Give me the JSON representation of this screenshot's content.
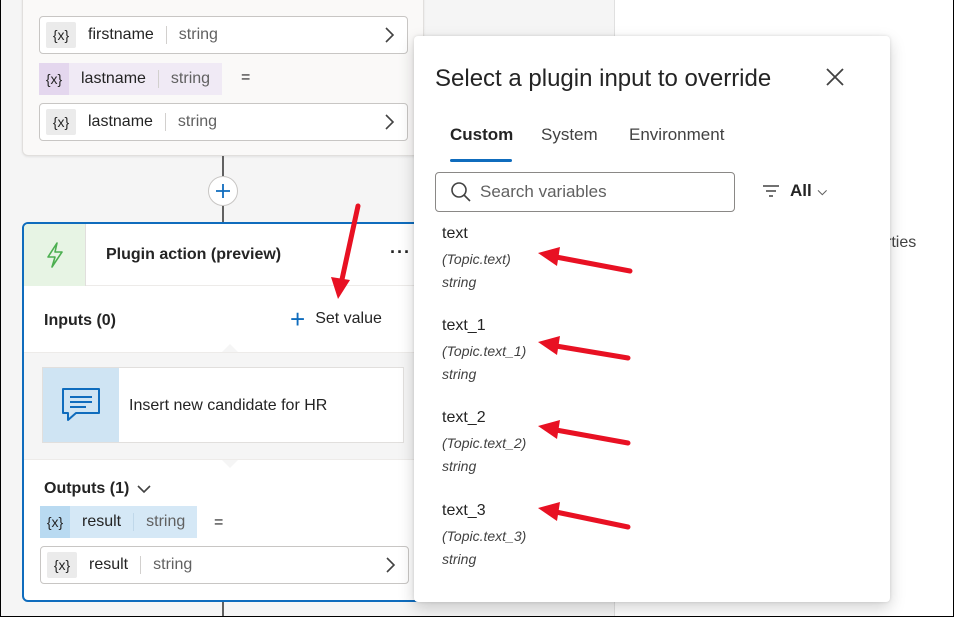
{
  "canvas": {
    "top_card": {
      "rows": [
        {
          "icon": "{x}",
          "name": "firstname",
          "type": "string"
        },
        {
          "icon": "{x}",
          "name": "lastname",
          "type": "string"
        }
      ],
      "assign": {
        "icon": "{x}",
        "name": "lastname",
        "type": "string",
        "eq": "="
      }
    },
    "plugin_card": {
      "title": "Plugin action (preview)",
      "more": "···",
      "inputs_label": "Inputs (0)",
      "set_value_label": "Set value",
      "message_text": "Insert new candidate for HR",
      "outputs_label": "Outputs (1)",
      "output_chip": {
        "icon": "{x}",
        "name": "result",
        "type": "string",
        "eq": "="
      },
      "output_row": {
        "icon": "{x}",
        "name": "result",
        "type": "string"
      }
    }
  },
  "right_panel_fragment": "rties",
  "flyout": {
    "title": "Select a plugin input to override",
    "tabs": [
      "Custom",
      "System",
      "Environment"
    ],
    "active_tab": "Custom",
    "search_placeholder": "Search variables",
    "filter_label": "All",
    "variables": [
      {
        "name": "text",
        "path": "(Topic.text)",
        "type": "string"
      },
      {
        "name": "text_1",
        "path": "(Topic.text_1)",
        "type": "string"
      },
      {
        "name": "text_2",
        "path": "(Topic.text_2)",
        "type": "string"
      },
      {
        "name": "text_3",
        "path": "(Topic.text_3)",
        "type": "string"
      }
    ]
  },
  "colors": {
    "accent": "#0f6cbd",
    "annotation_arrow": "#e81123",
    "plugin_icon": "#4caf50"
  }
}
